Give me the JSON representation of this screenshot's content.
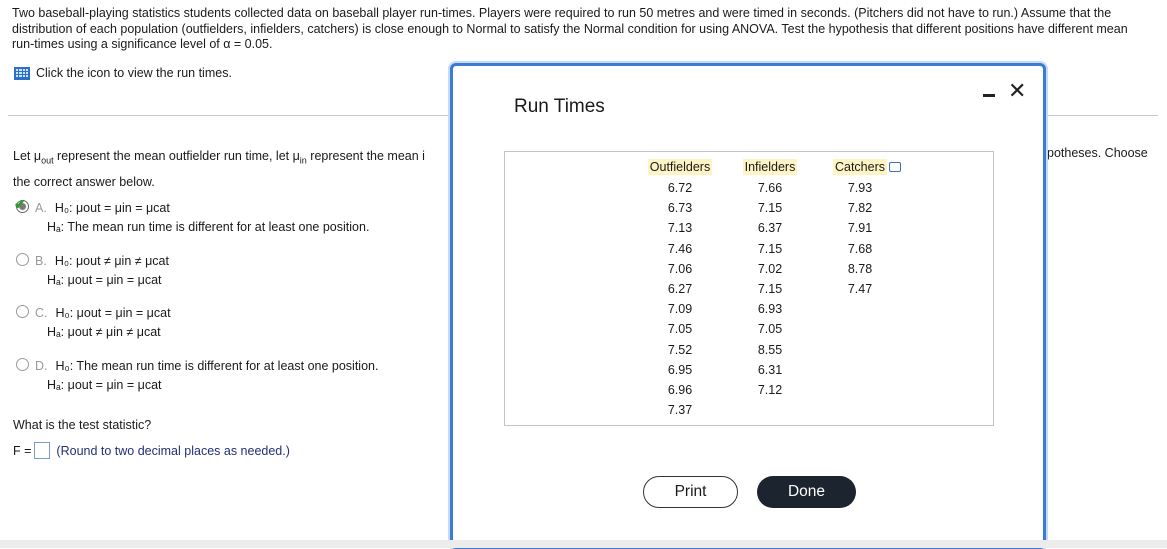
{
  "problem_text": "Two baseball-playing statistics students collected data on baseball player run-times. Players were required to run 50 metres and were timed in seconds. (Pitchers did not have to run.) Assume that the distribution of each population (outfielders, infielders, catchers) is close enough to Normal to satisfy the Normal condition for using ANOVA. Test the hypothesis that different positions have different mean run-times using a significance level of α = 0.05.",
  "icon_link_text": "Click the icon to view the run times.",
  "let_text_start": "Let μ",
  "let_sub_out": "out",
  "let_text_mid": " represent the mean outfielder run time, let μ",
  "let_sub_in": "in",
  "let_text_end": " represent the mean i",
  "let_text_right": "potheses. Choose",
  "choose_text": "the correct answer below.",
  "options": [
    {
      "letter": "A.",
      "h0": "H₀: μout = μin = μcat",
      "ha": "Hₐ: The mean run time is different for at least one position."
    },
    {
      "letter": "B.",
      "h0": "H₀: μout ≠ μin ≠ μcat",
      "ha": "Hₐ: μout = μin = μcat"
    },
    {
      "letter": "C.",
      "h0": "H₀: μout = μin = μcat",
      "ha": "Hₐ: μout ≠ μin ≠ μcat"
    },
    {
      "letter": "D.",
      "h0": "H₀: The mean run time is different for at least one position.",
      "ha": "Hₐ: μout = μin = μcat"
    }
  ],
  "question": "What is the test statistic?",
  "f_label": "F =",
  "f_hint": "(Round to two decimal places as needed.)",
  "modal": {
    "title": "Run Times",
    "headers": [
      "Outfielders",
      "Infielders",
      "Catchers"
    ],
    "outfielders": [
      "6.72",
      "6.73",
      "7.13",
      "7.46",
      "7.06",
      "6.27",
      "7.09",
      "7.05",
      "7.52",
      "6.95",
      "6.96",
      "7.37"
    ],
    "infielders": [
      "7.66",
      "7.15",
      "6.37",
      "7.15",
      "7.02",
      "7.15",
      "6.93",
      "7.05",
      "8.55",
      "6.31",
      "7.12",
      ""
    ],
    "catchers": [
      "7.93",
      "7.82",
      "7.91",
      "7.68",
      "8.78",
      "7.47",
      "",
      "",
      "",
      "",
      "",
      ""
    ],
    "print_label": "Print",
    "done_label": "Done"
  }
}
